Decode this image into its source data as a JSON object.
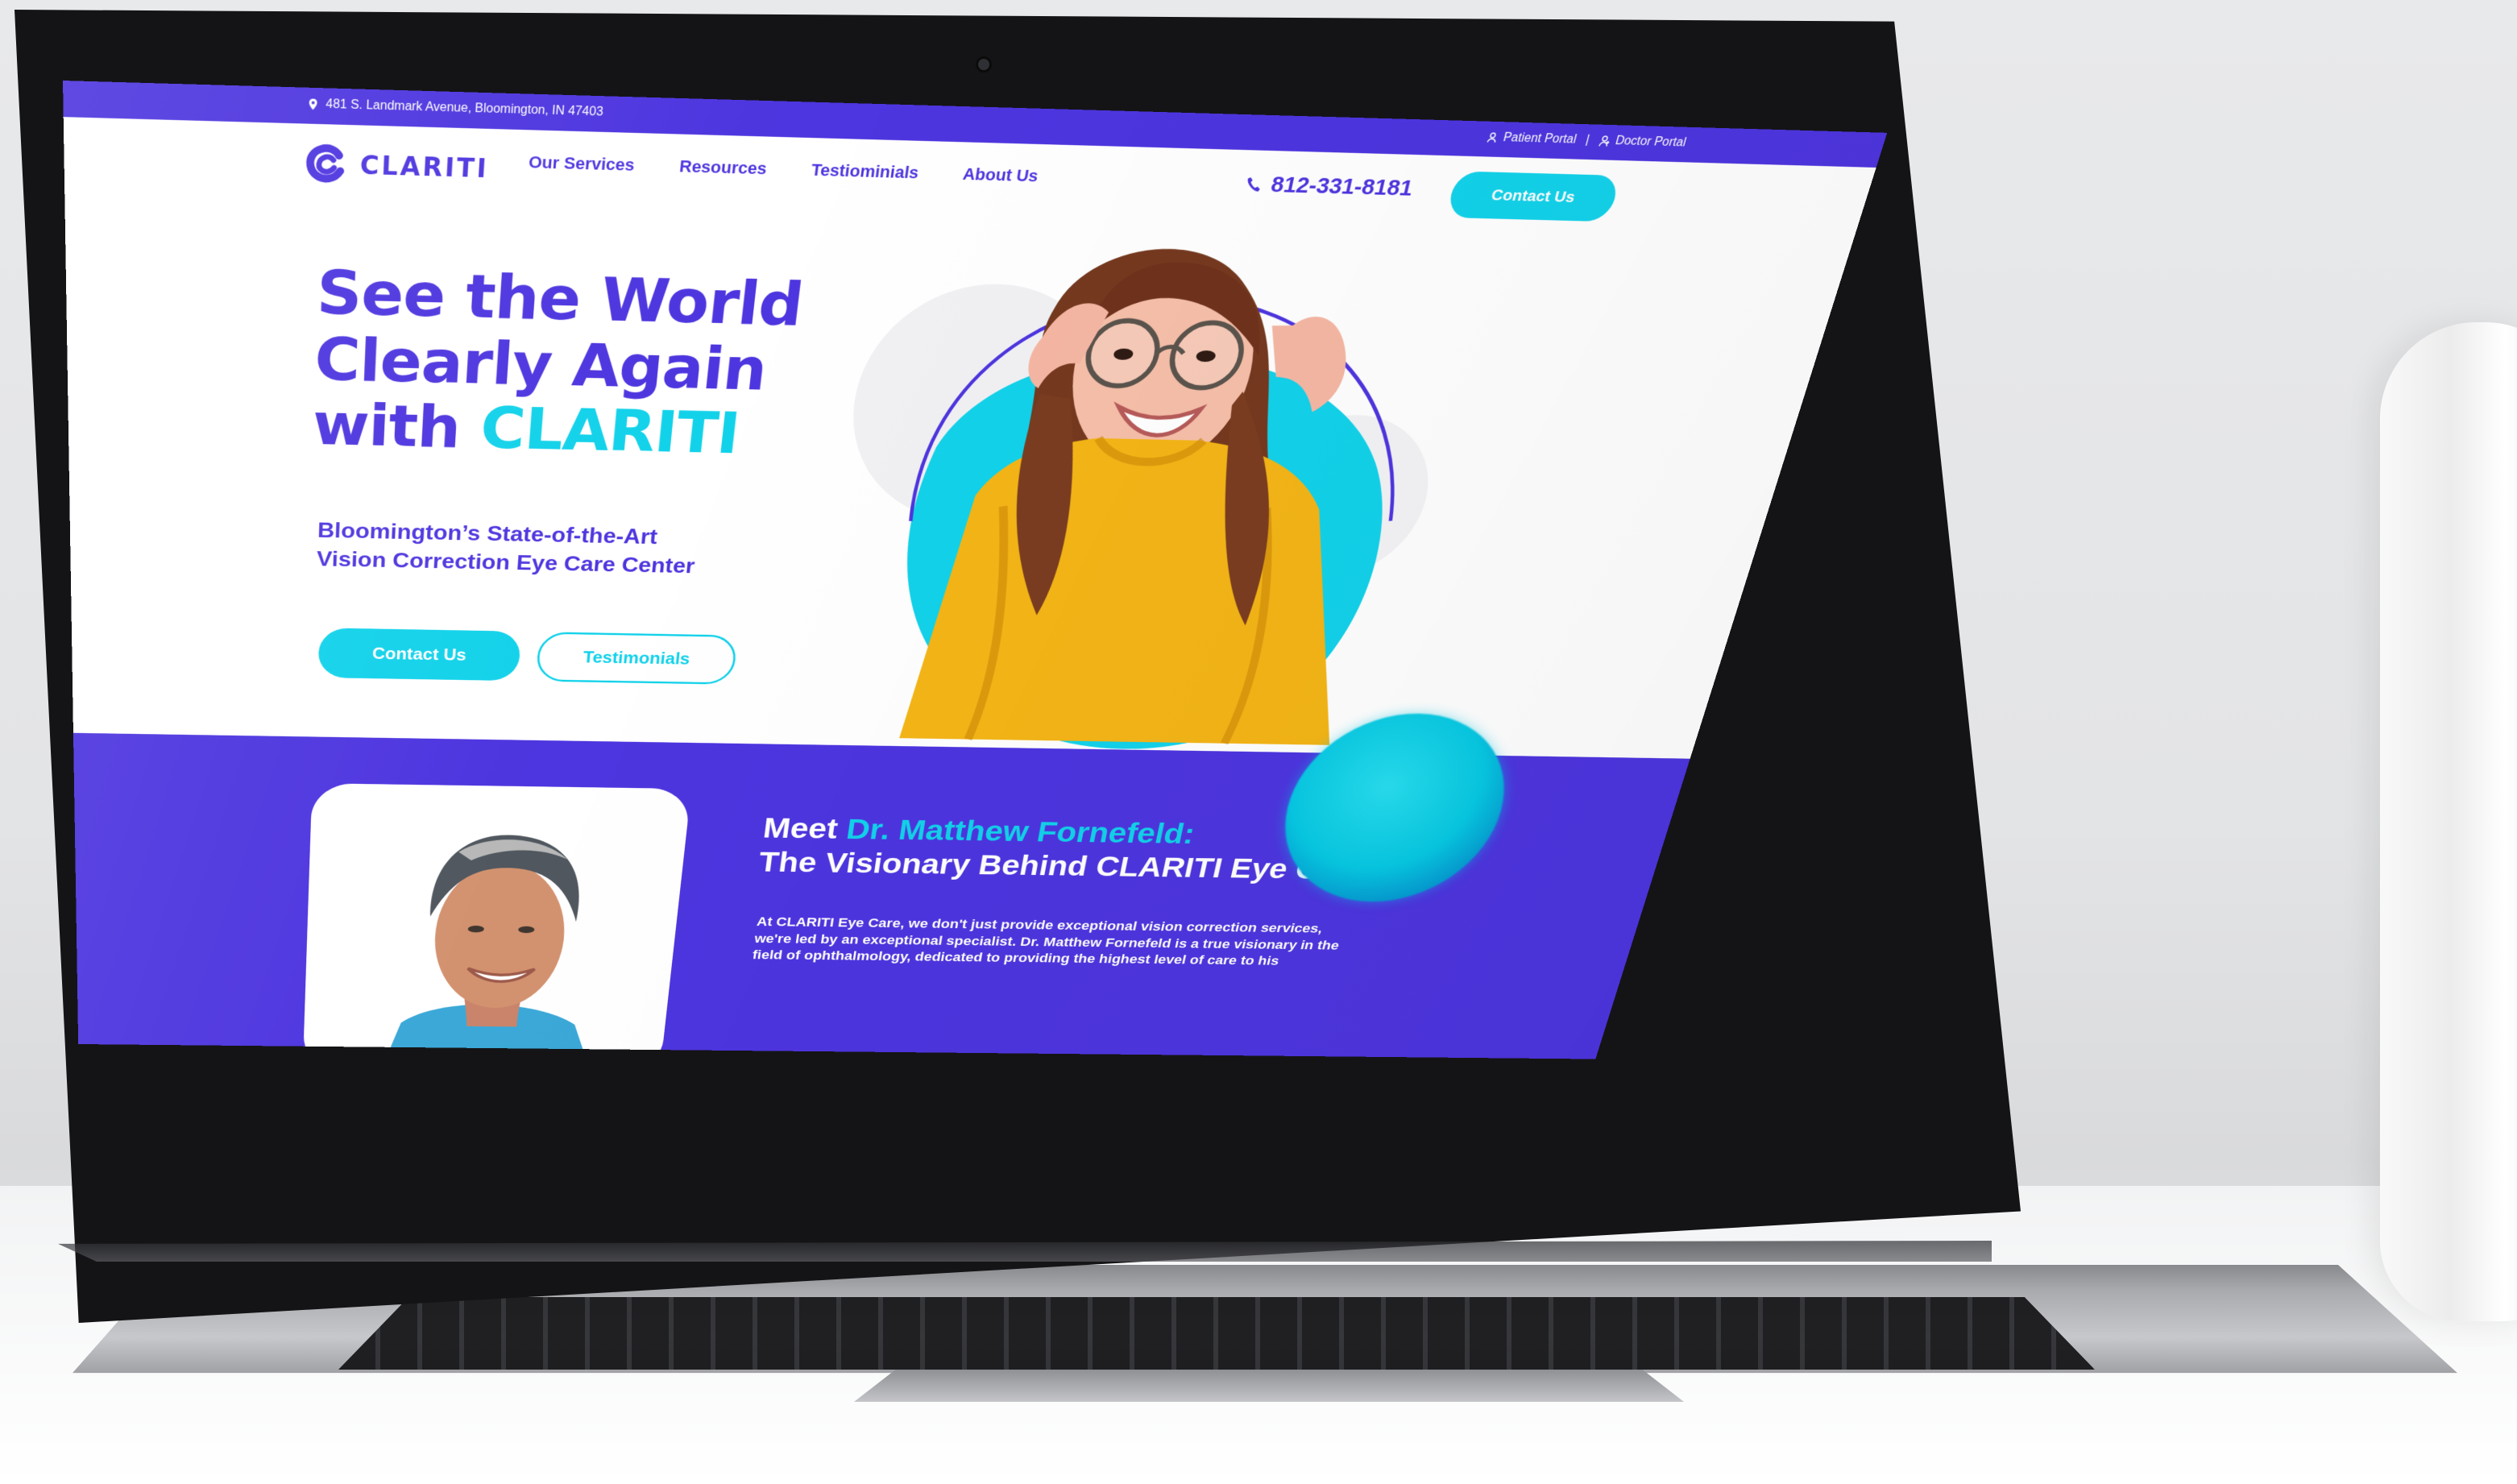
{
  "top_bar": {
    "address": "481 S. Landmark Avenue, Bloomington, IN 47403",
    "patient_portal": "Patient Portal",
    "separator": "|",
    "doctor_portal": "Doctor Portal"
  },
  "header": {
    "logo_text": "CLARITI",
    "nav": [
      {
        "label": "Our Services"
      },
      {
        "label": "Resources"
      },
      {
        "label": "Testiominials"
      },
      {
        "label": "About Us"
      }
    ],
    "phone": "812-331-8181",
    "contact_button": "Contact Us"
  },
  "hero": {
    "title_line_1": "See the World",
    "title_line_2": "Clearly Again",
    "title_prefix": "with",
    "title_accent": "CLARITI",
    "subtitle_line_1": "Bloomington’s State-of-the-Art",
    "subtitle_line_2": "Vision Correction Eye Care Center",
    "primary_button": "Contact Us",
    "secondary_button": "Testimonials"
  },
  "doctor": {
    "heading_prefix": "Meet",
    "name": "Dr. Matthew Fornefeld:",
    "heading_line_2": "The Visionary Behind CLARITI Eye Care",
    "bio_lines": [
      "At CLARITI Eye Care, we don't just provide exceptional vision correction services,",
      "we're led by an exceptional specialist. Dr. Matthew Fornefeld is a true visionary in the",
      "field of ophthalmology, dedicated to providing the highest level of care to his"
    ]
  },
  "colors": {
    "brand_purple": "#4d35df",
    "brand_cyan": "#12d2ea",
    "hero_sweater": "#f4b516"
  },
  "icons": {
    "address": "map-pin-icon",
    "patient_portal": "user-icon",
    "doctor_portal": "doctor-icon",
    "phone": "phone-icon"
  }
}
